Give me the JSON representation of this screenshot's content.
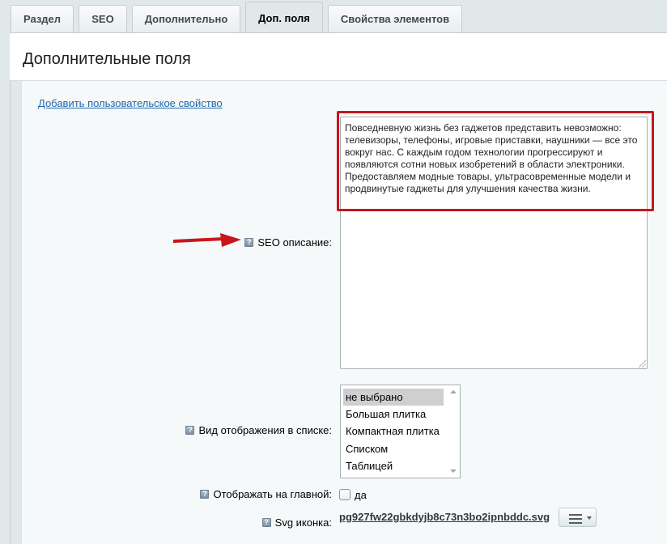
{
  "tabs": [
    {
      "label": "Раздел",
      "active": false
    },
    {
      "label": "SEO",
      "active": false
    },
    {
      "label": "Дополнительно",
      "active": false
    },
    {
      "label": "Доп. поля",
      "active": true
    },
    {
      "label": "Свойства элементов",
      "active": false
    }
  ],
  "panel": {
    "title": "Дополнительные поля",
    "add_link": "Добавить пользовательское свойство"
  },
  "fields": {
    "seo_description": {
      "label": "SEO описание:",
      "value": "Повседневную жизнь без гаджетов представить невозможно: телевизоры, телефоны, игровые приставки, наушники — все это вокруг нас. С каждым годом технологии прогрессируют и появляются сотни новых изобретений в области электроники. Предоставляем модные товары, ультрасовременные модели и продвинутые гаджеты для улучшения качества жизни."
    },
    "list_view": {
      "label": "Вид отображения в списке:",
      "options": [
        "не выбрано",
        "Большая плитка",
        "Компактная плитка",
        "Списком",
        "Таблицей"
      ],
      "selected": "не выбрано"
    },
    "show_on_main": {
      "label": "Отображать на главной:",
      "checkbox_label": "да",
      "checked": false
    },
    "svg_icon": {
      "label": "Svg иконка:",
      "file_name": "pg927fw22gbkdyjb8c73n3bo2ipnbddc.svg"
    }
  },
  "help_icon_glyph": "?",
  "colors": {
    "highlight_border": "#c8161d",
    "link": "#2067b0",
    "background": "#e0e8ea"
  }
}
